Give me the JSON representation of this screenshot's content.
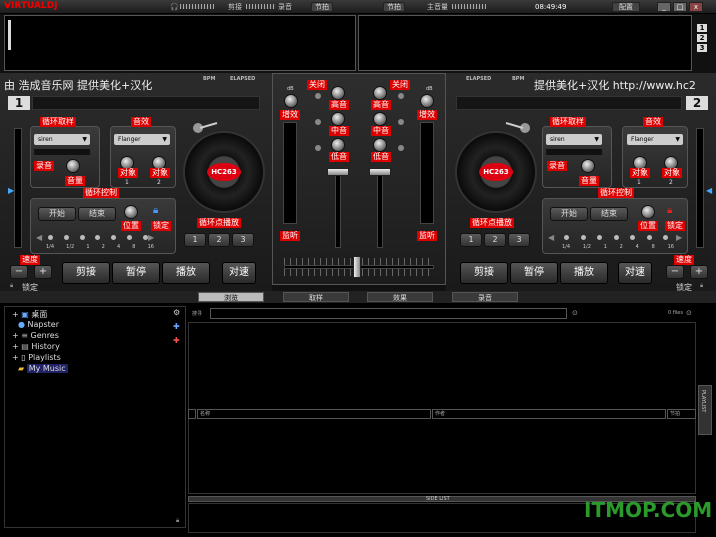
{
  "topbar": {
    "logo_a": "VIRTUAL",
    "logo_b": "DJ",
    "cut_label": "剪接",
    "record_label": "录音",
    "beat_label": "节拍",
    "beat2_label": "节拍",
    "master_label": "主音量",
    "clock": "08:49:49",
    "config_label": "配置",
    "win_min": "_",
    "win_max": "□",
    "win_close": "x"
  },
  "wave": {
    "n1": "1",
    "n2": "2",
    "n3": "3"
  },
  "left_deck": {
    "ticker": "由 浩成音乐网 提供美化+汉化",
    "bpm": "BPM",
    "elapsed": "ELAPSED",
    "number": "1",
    "loop_sample_title": "循环取样",
    "loop_sample_select": "siren",
    "rec_label": "录音",
    "volume_label": "音量",
    "effect_title": "音效",
    "effect_select": "Flanger",
    "obj1": "对象",
    "obj1_n": "1",
    "obj2": "对象",
    "obj2_n": "2",
    "platter_label": "HC263",
    "loop_ctrl_title": "循环控制",
    "start": "开始",
    "end": "结束",
    "position": "位置",
    "lock": "锁定",
    "loop_ticks": [
      "1/4",
      "1/2",
      "1",
      "2",
      "4",
      "8",
      "16"
    ],
    "cue_loop_title": "循环点播放",
    "cue1": "1",
    "cue2": "2",
    "cue3": "3",
    "speed": "速度",
    "minus": "−",
    "plus": "+",
    "lock2": "锁定",
    "cut_btn": "剪接",
    "pause_btn": "暂停",
    "play_btn": "播放",
    "sync_btn": "对速"
  },
  "right_deck": {
    "ticker": "提供美化+汉化 http://www.hc2",
    "elapsed": "ELAPSED",
    "bpm": "BPM",
    "number": "2",
    "loop_sample_title": "循环取样",
    "loop_sample_select": "siren",
    "rec_label": "录音",
    "volume_label": "音量",
    "effect_title": "音效",
    "effect_select": "Flanger",
    "obj1": "对象",
    "obj1_n": "1",
    "obj2": "对象",
    "obj2_n": "2",
    "platter_label": "HC263",
    "loop_ctrl_title": "循环控制",
    "start": "开始",
    "end": "结束",
    "position": "位置",
    "lock": "锁定",
    "loop_ticks": [
      "1/4",
      "1/2",
      "1",
      "2",
      "4",
      "8",
      "16"
    ],
    "cue_loop_title": "循环点播放",
    "cue1": "1",
    "cue2": "2",
    "cue3": "3",
    "speed": "速度",
    "minus": "−",
    "plus": "+",
    "lock2": "锁定",
    "cut_btn": "剪接",
    "pause_btn": "暂停",
    "play_btn": "播放",
    "sync_btn": "对速"
  },
  "mixer": {
    "off_l": "关闭",
    "off_r": "关闭",
    "db_l": "dB",
    "db_r": "dB",
    "gain_l": "增效",
    "gain_r": "增效",
    "high_l": "高音",
    "high_r": "高音",
    "mid_l": "中音",
    "mid_r": "中音",
    "low_l": "低音",
    "low_r": "低音",
    "monitor_l": "监听",
    "monitor_r": "监听"
  },
  "tabs": [
    "浏览",
    "取样",
    "效果",
    "录音"
  ],
  "browser": {
    "tree": [
      "桌面",
      "Napster",
      "Genres",
      "History",
      "Playlists",
      "My Music"
    ],
    "search_label": "搜寻",
    "files_count": "0 files",
    "col_title": "名称",
    "col_artist": "作者",
    "col_bpm": "节拍",
    "sidelist": "SIDE LIST",
    "playlist": "PLAYLIST"
  },
  "watermark": "ITMOP.COM"
}
